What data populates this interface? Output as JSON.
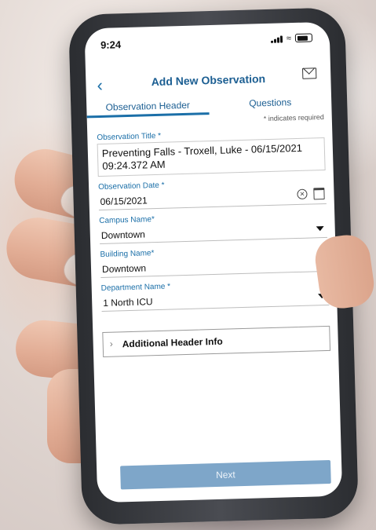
{
  "status_bar": {
    "time": "9:24"
  },
  "header": {
    "title": "Add New Observation"
  },
  "tabs": [
    {
      "label": "Observation Header",
      "active": true
    },
    {
      "label": "Questions",
      "active": false
    }
  ],
  "form": {
    "required_note": "* indicates required",
    "observation_title": {
      "label": "Observation Title *",
      "value_line1": "Preventing Falls - Troxell, Luke - 06/15/2021",
      "value_line2": "09:24.372  AM"
    },
    "observation_date": {
      "label": "Observation Date *",
      "value": "06/15/2021"
    },
    "campus_name": {
      "label": "Campus Name*",
      "value": "Downtown"
    },
    "building_name": {
      "label": "Building Name*",
      "value": "Downtown"
    },
    "department_name": {
      "label": "Department Name *",
      "value": "1 North ICU"
    },
    "additional_header": {
      "label": "Additional Header Info"
    }
  },
  "footer": {
    "next_label": "Next"
  },
  "colors": {
    "accent": "#1b6fa8",
    "button": "#7ea6c9"
  }
}
